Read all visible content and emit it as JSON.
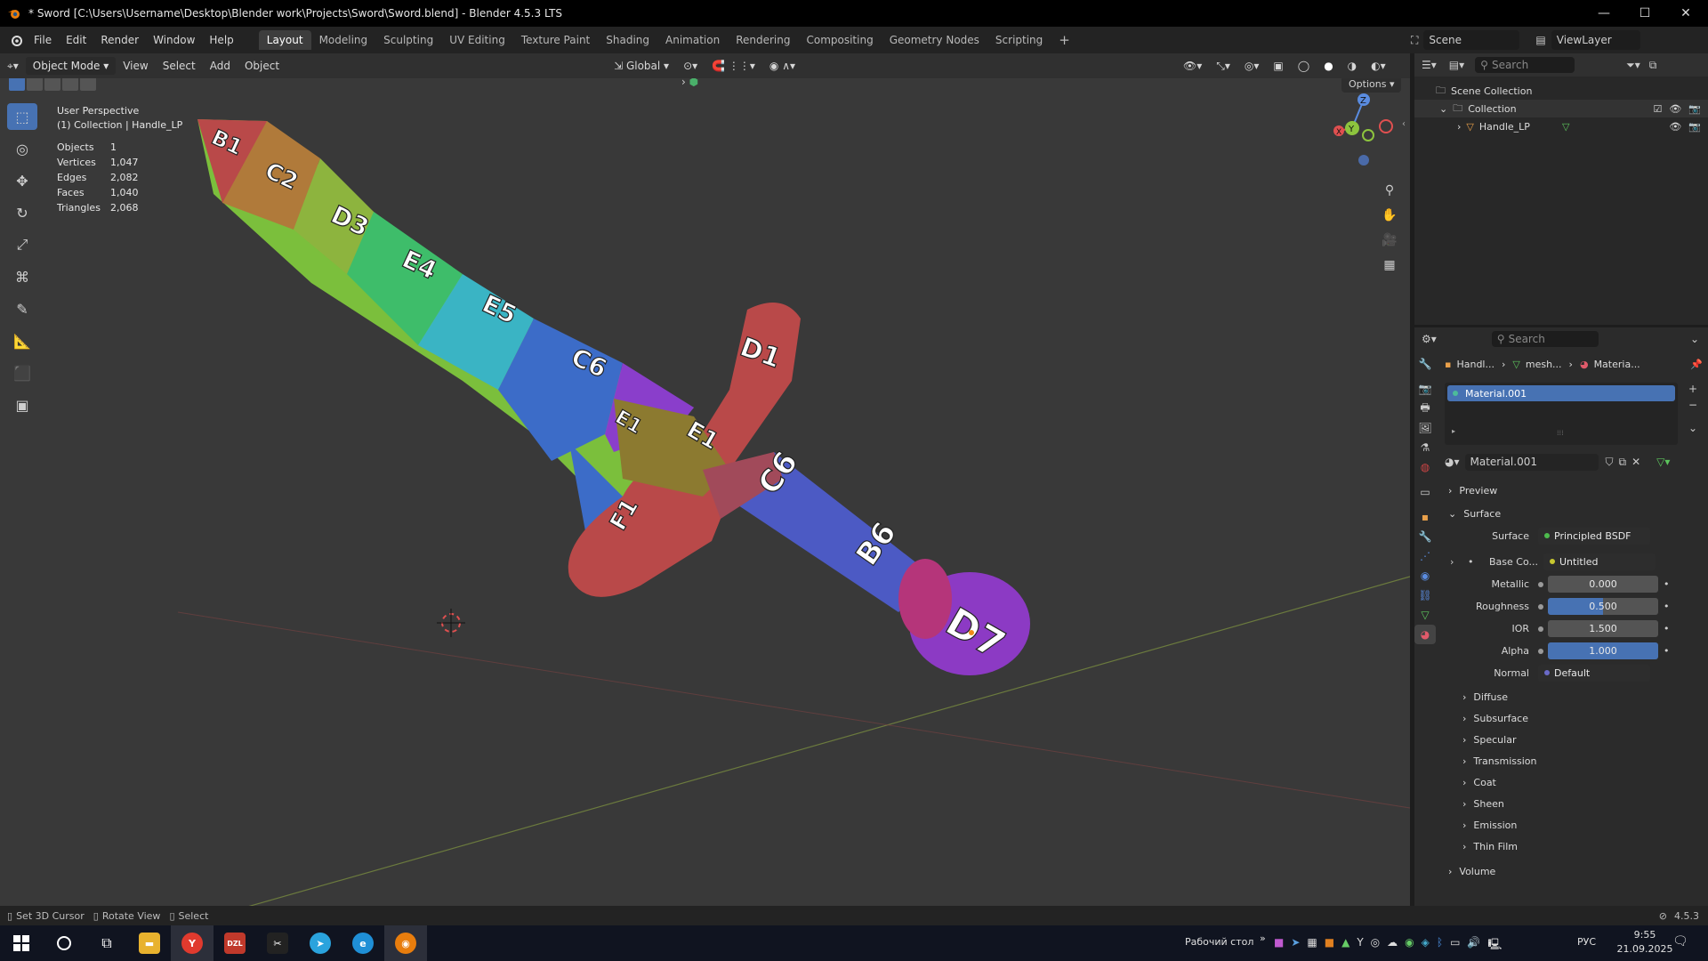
{
  "window": {
    "title": "* Sword [C:\\Users\\Username\\Desktop\\Blender work\\Projects\\Sword\\Sword.blend] - Blender 4.5.3 LTS",
    "minimize": "—",
    "maximize": "☐",
    "close": "✕"
  },
  "menu": [
    "File",
    "Edit",
    "Render",
    "Window",
    "Help"
  ],
  "workspaces": [
    "Layout",
    "Modeling",
    "Sculpting",
    "UV Editing",
    "Texture Paint",
    "Shading",
    "Animation",
    "Rendering",
    "Compositing",
    "Geometry Nodes",
    "Scripting"
  ],
  "active_workspace": "Layout",
  "add_workspace": "+",
  "scene": {
    "name": "Scene",
    "view_layer": "ViewLayer"
  },
  "viewport_header": {
    "mode": "Object Mode",
    "menus": [
      "View",
      "Select",
      "Add",
      "Object"
    ],
    "orientation": "Global",
    "options": "Options"
  },
  "viewport_info": {
    "perspective": "User Perspective",
    "collection": "(1) Collection | Handle_LP"
  },
  "stats": [
    {
      "label": "Objects",
      "value": "1"
    },
    {
      "label": "Vertices",
      "value": "1,047"
    },
    {
      "label": "Edges",
      "value": "2,082"
    },
    {
      "label": "Faces",
      "value": "1,040"
    },
    {
      "label": "Triangles",
      "value": "2,068"
    }
  ],
  "gizmo": {
    "x": "X",
    "y": "Y",
    "z": "Z"
  },
  "uv_labels": {
    "blade": [
      "B1",
      "C2",
      "D3",
      "E4",
      "E5",
      "C6"
    ],
    "guard": [
      "D1",
      "E1",
      "E1",
      "F1"
    ],
    "handle": [
      "C6",
      "B6"
    ],
    "pommel": "D7"
  },
  "outliner": {
    "search_placeholder": "Search",
    "root": "Scene Collection",
    "collection": "Collection",
    "object": "Handle_LP"
  },
  "properties": {
    "search_placeholder": "Search",
    "breadcrumb": [
      "Handl...",
      "mesh...",
      "Materia..."
    ],
    "slot": "Material.001",
    "material_name": "Material.001",
    "sections_top": [
      "Preview",
      "Surface"
    ],
    "surface_shader": "Principled BSDF",
    "fields": [
      {
        "label": "Surface",
        "value": "Principled BSDF",
        "kind": "dark",
        "dot": "#4dbb4d"
      },
      {
        "label": "Base Co...",
        "value": "Untitled",
        "kind": "dark",
        "dot": "#c8c830"
      },
      {
        "label": "Metallic",
        "value": "0.000",
        "kind": "gray",
        "dot": "#9a9a9a"
      },
      {
        "label": "Roughness",
        "value": "0.500",
        "kind": "blue",
        "dot": "#9a9a9a"
      },
      {
        "label": "IOR",
        "value": "1.500",
        "kind": "gray",
        "dot": "#9a9a9a"
      },
      {
        "label": "Alpha",
        "value": "1.000",
        "kind": "blue",
        "dot": "#9a9a9a"
      },
      {
        "label": "Normal",
        "value": "Default",
        "kind": "dark",
        "dot": "#6a6ac8"
      }
    ],
    "subpanels": [
      "Diffuse",
      "Subsurface",
      "Specular",
      "Transmission",
      "Coat",
      "Sheen",
      "Emission",
      "Thin Film"
    ],
    "volume": "Volume"
  },
  "statusbar": {
    "items": [
      "Set 3D Cursor",
      "Rotate View",
      "Select"
    ],
    "version": "4.5.3"
  },
  "taskbar": {
    "apps": [
      {
        "name": "explorer",
        "label": "▬",
        "color": "#e8b22e"
      },
      {
        "name": "yandex",
        "label": "Y",
        "color": "#e03a2e"
      },
      {
        "name": "dzl",
        "label": "DZL",
        "color": "#c0392b"
      },
      {
        "name": "capcut",
        "label": "✂",
        "color": "#222222"
      },
      {
        "name": "telegram",
        "label": "➤",
        "color": "#2aa3dd"
      },
      {
        "name": "edge",
        "label": "e",
        "color": "#1f8fd6"
      },
      {
        "name": "blender",
        "label": "◉",
        "color": "#e87d0d"
      }
    ],
    "desktop_label": "Рабочий стол",
    "more": "»",
    "lang": "РУС",
    "time": "9:55",
    "date": "21.09.2025"
  }
}
